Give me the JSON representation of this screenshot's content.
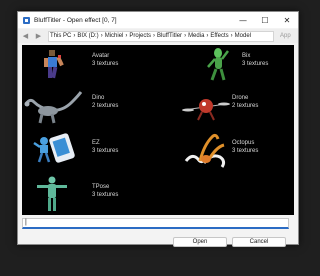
{
  "window": {
    "title": "BluffTitler - Open effect [0, 7]",
    "minimize_glyph": "—",
    "maximize_glyph": "☐",
    "close_glyph": "✕"
  },
  "toolbar": {
    "back_glyph": "◀",
    "forward_glyph": "▶",
    "breadcrumbs": [
      "This PC",
      "BIX (D:)",
      "Michiel",
      "Projects",
      "BluffTitler",
      "Media",
      "Effects",
      "Model"
    ],
    "separator": "›",
    "app_button": "App"
  },
  "effects": [
    {
      "name": "Avatar",
      "info": "3 textures",
      "icon": "avatar-figure-icon"
    },
    {
      "name": "Bix",
      "info": "3 textures",
      "icon": "bix-alien-icon"
    },
    {
      "name": "Dino",
      "info": "2 textures",
      "icon": "dino-icon"
    },
    {
      "name": "Drone",
      "info": "2 textures",
      "icon": "drone-icon"
    },
    {
      "name": "EZ",
      "info": "3 textures",
      "icon": "ez-character-icon"
    },
    {
      "name": "Octopus",
      "info": "3 textures",
      "icon": "octopus-icon"
    },
    {
      "name": "TPose",
      "info": "3 textures",
      "icon": "tpose-figure-icon"
    }
  ],
  "filename": {
    "value": "|"
  },
  "buttons": {
    "open_label": "Open",
    "cancel_label": "Cancel"
  }
}
